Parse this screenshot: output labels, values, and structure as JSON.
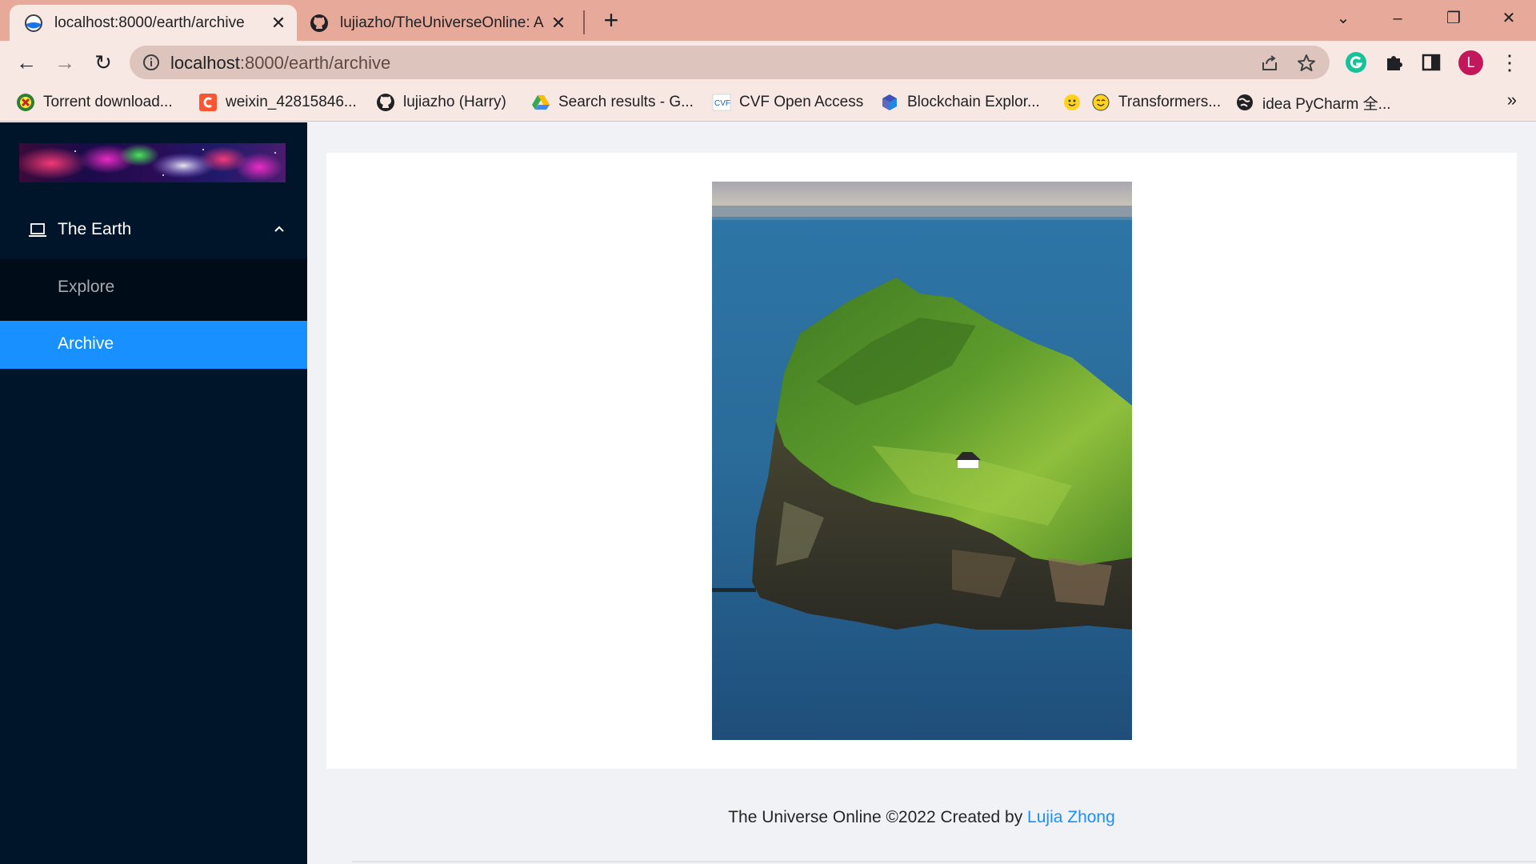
{
  "browser": {
    "tabs": [
      {
        "title": "localhost:8000/earth/archive",
        "active": true,
        "icon": "globe-icon"
      },
      {
        "title": "lujiazho/TheUniverseOnline: A",
        "active": false,
        "icon": "github-icon"
      }
    ],
    "url_host": "localhost",
    "url_path": ":8000/earth/archive",
    "profile_initial": "L",
    "bookmarks": [
      {
        "label": "Torrent download...",
        "icon": "torrent-icon"
      },
      {
        "label": "weixin_42815846...",
        "icon": "csdn-icon"
      },
      {
        "label": "lujiazho (Harry)",
        "icon": "github-icon"
      },
      {
        "label": "Search results - G...",
        "icon": "google-drive-icon"
      },
      {
        "label": "CVF Open Access",
        "icon": "cvf-icon"
      },
      {
        "label": "Blockchain Explor...",
        "icon": "blockchain-icon"
      },
      {
        "label": "",
        "icon": "hugging-face-icon"
      },
      {
        "label": "Transformers...",
        "icon": "hugging-face-icon"
      },
      {
        "label": "idea PyCharm 全...",
        "icon": "globe-icon"
      }
    ]
  },
  "sidebar": {
    "menu_title": "The Earth",
    "items": [
      {
        "label": "Explore",
        "selected": false
      },
      {
        "label": "Archive",
        "selected": true
      }
    ]
  },
  "main": {
    "image_subject": "island-photo"
  },
  "footer": {
    "text": "The Universe Online ©2022 Created by ",
    "author": "Lujia Zhong"
  },
  "colors": {
    "sider_bg": "#001529",
    "submenu_bg": "#000c17",
    "selected": "#1890ff",
    "tabstrip": "#e6a99a"
  }
}
